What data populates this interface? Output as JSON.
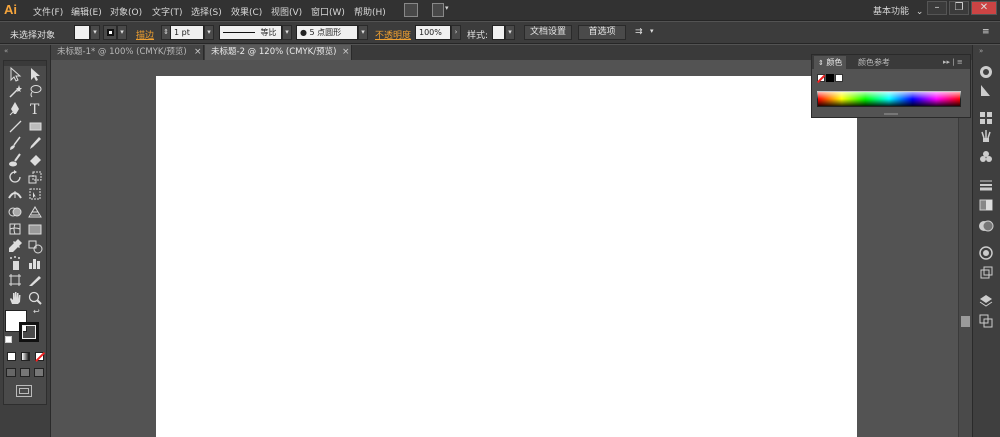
{
  "app": {
    "logo": "Ai"
  },
  "menu": [
    "文件(F)",
    "编辑(E)",
    "对象(O)",
    "文字(T)",
    "选择(S)",
    "效果(C)",
    "视图(V)",
    "窗口(W)",
    "帮助(H)"
  ],
  "workspace": {
    "label": "基本功能",
    "chevron": "⌄"
  },
  "window_controls": {
    "minimize": "–",
    "restore": "❐",
    "close": "✕"
  },
  "control_bar": {
    "selection_status": "未选择对象",
    "stroke_label": "描边",
    "stroke_weight": "1 pt",
    "stroke_style": "等比",
    "brush": "● 5 点圆形",
    "opacity_label": "不透明度",
    "opacity_value": "100%",
    "style_label": "样式:",
    "doc_setup_button": "文档设置",
    "preferences_button": "首选项",
    "arrange_icon": "⇉"
  },
  "tabs": [
    {
      "label": "未标题-1* @ 100% (CMYK/预览)",
      "active": false,
      "close": "×"
    },
    {
      "label": "未标题-2 @ 120% (CMYK/预览)",
      "active": true,
      "close": "×"
    }
  ],
  "color_panel": {
    "tabs": [
      "颜色",
      "颜色参考"
    ],
    "active_tab": "颜色",
    "menu_icon": "▸▸ | ≡"
  },
  "colors": {
    "accent": "#f0a030",
    "logo": "#f6a53c",
    "artboard": "#ffffff",
    "canvas_bg": "#535353"
  },
  "tools": [
    "selection-tool",
    "direct-selection-tool",
    "magic-wand-tool",
    "lasso-tool",
    "pen-tool",
    "type-tool",
    "line-tool",
    "rectangle-tool",
    "paintbrush-tool",
    "pencil-tool",
    "blob-brush-tool",
    "eraser-tool",
    "rotate-tool",
    "scale-tool",
    "width-tool",
    "free-transform-tool",
    "shape-builder-tool",
    "perspective-grid-tool",
    "mesh-tool",
    "gradient-tool",
    "eyedropper-tool",
    "blend-tool",
    "symbol-sprayer-tool",
    "column-graph-tool",
    "artboard-tool",
    "slice-tool",
    "hand-tool",
    "zoom-tool"
  ]
}
